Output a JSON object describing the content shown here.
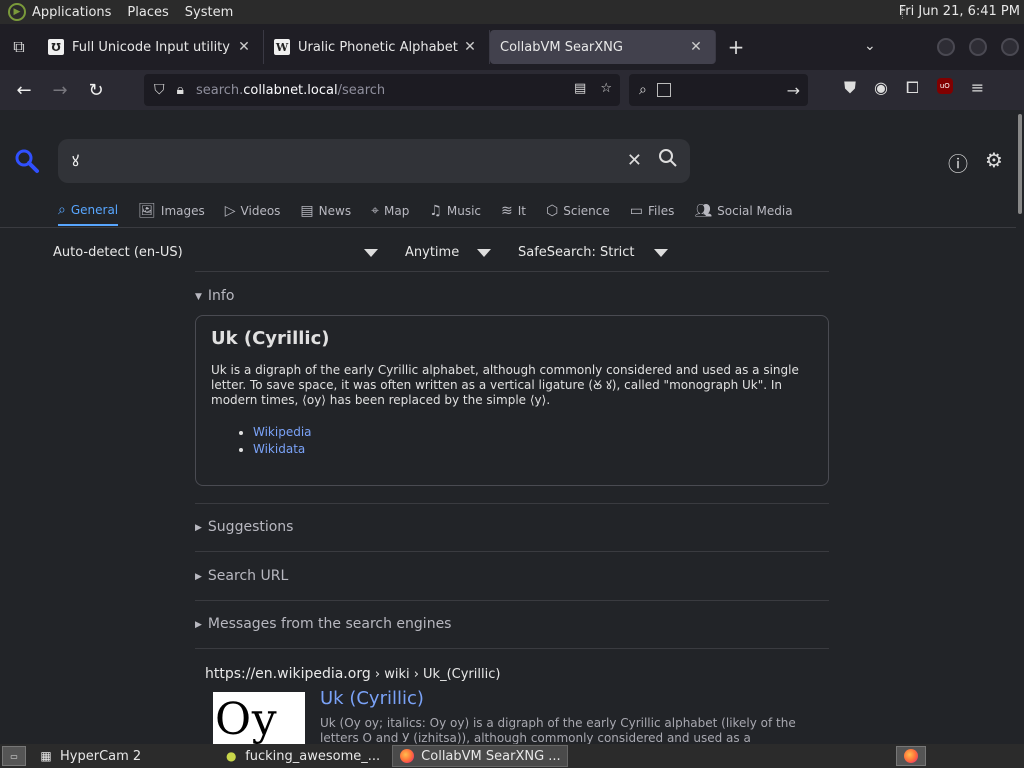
{
  "panel": {
    "menus": [
      "Applications",
      "Places",
      "System"
    ],
    "clock": "Fri Jun 21,  6:41 PM"
  },
  "browser": {
    "tabs": [
      {
        "title": "Full Unicode Input utility",
        "favicon": "Ʊ",
        "active": false
      },
      {
        "title": "Uralic Phonetic Alphabet - W",
        "favicon": "W",
        "active": false
      },
      {
        "title": "CollabVM SearXNG",
        "favicon": "",
        "active": true
      }
    ],
    "url_host_prefix": "search.",
    "url_domain": "collabnet.local",
    "url_path": "/search"
  },
  "search": {
    "query": "ꙋ",
    "categories": [
      {
        "label": "General",
        "icon": "search-icon",
        "active": true
      },
      {
        "label": "Images",
        "icon": "image-icon",
        "active": false
      },
      {
        "label": "Videos",
        "icon": "play-icon",
        "active": false
      },
      {
        "label": "News",
        "icon": "newspaper-icon",
        "active": false
      },
      {
        "label": "Map",
        "icon": "map-pin-icon",
        "active": false
      },
      {
        "label": "Music",
        "icon": "music-note-icon",
        "active": false
      },
      {
        "label": "It",
        "icon": "layers-icon",
        "active": false
      },
      {
        "label": "Science",
        "icon": "cube-icon",
        "active": false
      },
      {
        "label": "Files",
        "icon": "folder-icon",
        "active": false
      },
      {
        "label": "Social Media",
        "icon": "people-icon",
        "active": false
      }
    ],
    "filters": {
      "language": "Auto-detect (en-US)",
      "time": "Anytime",
      "safesearch": "SafeSearch: Strict"
    },
    "sections": {
      "info": "Info",
      "suggestions": "Suggestions",
      "search_url": "Search URL",
      "messages": "Messages from the search engines"
    },
    "infobox": {
      "title": "Uk (Cyrillic)",
      "text": "Uk is a digraph of the early Cyrillic alphabet, although commonly considered and used as a single letter. To save space, it was often written as a vertical ligature (Ꙋ ꙋ), called \"monograph Uk\". In modern times, ⟨оу⟩ has been replaced by the simple ⟨у⟩.",
      "links": [
        "Wikipedia",
        "Wikidata"
      ]
    },
    "result": {
      "url": "https://en.wikipedia.org",
      "path": " › wiki › Uk_(Cyrillic)",
      "title": "Uk (Cyrillic)",
      "thumb_text": "Оу оу",
      "snippet": "Uk (Оу оу; italics: Оу оу) is a digraph of the early Cyrillic alphabet (likely of the letters О and У (izhitsa)), although commonly considered and used as a"
    }
  },
  "taskbar": {
    "items": [
      {
        "label": "HyperCam 2",
        "active": false
      },
      {
        "label": "fucking_awesome_...",
        "active": false
      },
      {
        "label": "CollabVM SearXNG ...",
        "active": true
      }
    ]
  }
}
